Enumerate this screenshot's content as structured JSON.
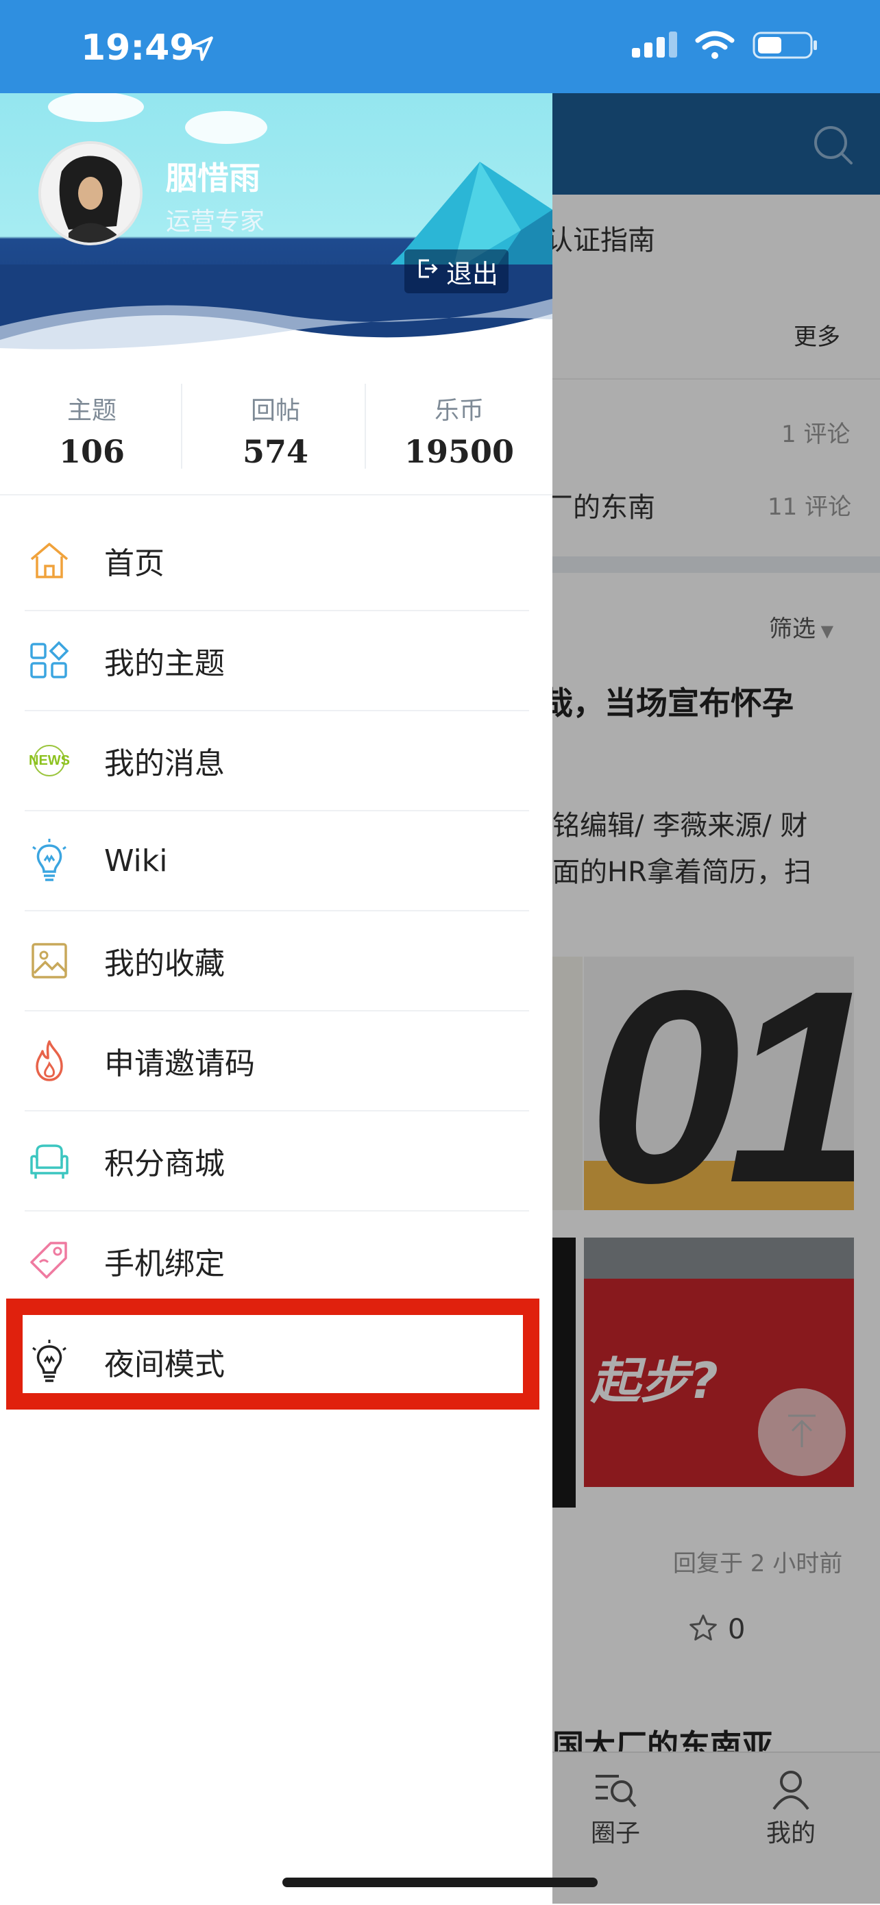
{
  "status_bar": {
    "time": "19:49"
  },
  "profile": {
    "name": "胭惜雨",
    "role": "运营专家",
    "logout_label": "退出"
  },
  "stats": [
    {
      "label": "主题",
      "value": "106"
    },
    {
      "label": "回帖",
      "value": "574"
    },
    {
      "label": "乐币",
      "value": "19500"
    }
  ],
  "menu": [
    {
      "label": "首页",
      "icon": "home-icon"
    },
    {
      "label": "我的主题",
      "icon": "grid-icon"
    },
    {
      "label": "我的消息",
      "icon": "news-icon"
    },
    {
      "label": "Wiki",
      "icon": "bulb-icon"
    },
    {
      "label": "我的收藏",
      "icon": "picture-icon"
    },
    {
      "label": "申请邀请码",
      "icon": "fire-icon"
    },
    {
      "label": "积分商城",
      "icon": "sofa-icon"
    },
    {
      "label": "手机绑定",
      "icon": "tag-icon"
    },
    {
      "label": "夜间模式",
      "icon": "night-bulb-icon"
    }
  ],
  "news_icon_text": "NEWS",
  "background_page": {
    "guide_text": "认证指南",
    "more_label": "更多",
    "comments_1": "1 评论",
    "row_2_text": "厂的东南",
    "comments_2": "11 评论",
    "filter_label": "筛选",
    "headline": "哉，当场宣布怀孕",
    "excerpt_line1": "铭编辑/ 李薇来源/ 财",
    "excerpt_line2": "面的HR拿着简历，扫",
    "image_big_text": "01",
    "image_text_2": "起步?",
    "reply_time": "回复于 2 小时前",
    "likes": "0",
    "headline_2": "国大厂的东南亚",
    "tab_circle": "圈子",
    "tab_mine": "我的"
  },
  "colors": {
    "status_bar": "#2f8fe0",
    "highlight": "#e0210d",
    "nav_header": "#1d5e96"
  }
}
